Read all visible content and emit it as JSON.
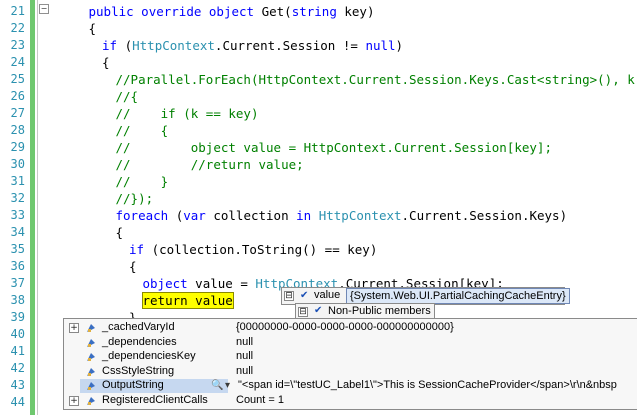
{
  "editor": {
    "collapse_glyph": "−",
    "lines": [
      {
        "num": "21",
        "indent": 3,
        "tokens": [
          {
            "t": "public override object ",
            "c": "kw"
          },
          {
            "t": "Get(",
            "c": ""
          },
          {
            "t": "string",
            "c": "kw"
          },
          {
            "t": " key)",
            "c": ""
          }
        ]
      },
      {
        "num": "22",
        "indent": 3,
        "tokens": [
          {
            "t": "{",
            "c": ""
          }
        ]
      },
      {
        "num": "23",
        "indent": 4,
        "tokens": [
          {
            "t": "if",
            "c": "kw"
          },
          {
            "t": " (",
            "c": ""
          },
          {
            "t": "HttpContext",
            "c": "ty"
          },
          {
            "t": ".Current.Session != ",
            "c": ""
          },
          {
            "t": "null",
            "c": "kw"
          },
          {
            "t": ")",
            "c": ""
          }
        ]
      },
      {
        "num": "24",
        "indent": 4,
        "tokens": [
          {
            "t": "{",
            "c": ""
          }
        ]
      },
      {
        "num": "25",
        "indent": 5,
        "tokens": [
          {
            "t": "//Parallel.ForEach(HttpContext.Current.Session.Keys.Cast<string>(), k =>",
            "c": "cm"
          }
        ]
      },
      {
        "num": "26",
        "indent": 5,
        "tokens": [
          {
            "t": "//{",
            "c": "cm"
          }
        ]
      },
      {
        "num": "27",
        "indent": 5,
        "tokens": [
          {
            "t": "//    if (k == key)",
            "c": "cm"
          }
        ]
      },
      {
        "num": "28",
        "indent": 5,
        "tokens": [
          {
            "t": "//    {",
            "c": "cm"
          }
        ]
      },
      {
        "num": "29",
        "indent": 5,
        "tokens": [
          {
            "t": "//        object value = HttpContext.Current.Session[key];",
            "c": "cm"
          }
        ]
      },
      {
        "num": "30",
        "indent": 5,
        "tokens": [
          {
            "t": "//        //return value;",
            "c": "cm"
          }
        ]
      },
      {
        "num": "31",
        "indent": 5,
        "tokens": [
          {
            "t": "//    }",
            "c": "cm"
          }
        ]
      },
      {
        "num": "32",
        "indent": 5,
        "tokens": [
          {
            "t": "//});",
            "c": "cm"
          }
        ]
      },
      {
        "num": "33",
        "indent": 5,
        "tokens": [
          {
            "t": "foreach",
            "c": "kw"
          },
          {
            "t": " (",
            "c": ""
          },
          {
            "t": "var",
            "c": "kw"
          },
          {
            "t": " collection ",
            "c": ""
          },
          {
            "t": "in",
            "c": "kw"
          },
          {
            "t": " ",
            "c": ""
          },
          {
            "t": "HttpContext",
            "c": "ty"
          },
          {
            "t": ".Current.Session.Keys)",
            "c": ""
          }
        ]
      },
      {
        "num": "34",
        "indent": 5,
        "tokens": [
          {
            "t": "{",
            "c": ""
          }
        ]
      },
      {
        "num": "35",
        "indent": 6,
        "tokens": [
          {
            "t": "if",
            "c": "kw"
          },
          {
            "t": " (collection.ToString() == key)",
            "c": ""
          }
        ]
      },
      {
        "num": "36",
        "indent": 6,
        "tokens": [
          {
            "t": "{",
            "c": ""
          }
        ]
      },
      {
        "num": "37",
        "indent": 7,
        "tokens": [
          {
            "t": "object",
            "c": "kw"
          },
          {
            "t": " value = ",
            "c": ""
          },
          {
            "t": "HttpContext",
            "c": "ty"
          },
          {
            "t": ".Current.Session[key];",
            "c": ""
          }
        ]
      },
      {
        "num": "38",
        "indent": 7,
        "tokens": [
          {
            "t": "return value",
            "c": "hl"
          }
        ]
      },
      {
        "num": "39",
        "indent": 6,
        "tokens": [
          {
            "t": "}",
            "c": ""
          }
        ]
      },
      {
        "num": "40",
        "indent": 0,
        "tokens": []
      },
      {
        "num": "41",
        "indent": 0,
        "tokens": []
      },
      {
        "num": "42",
        "indent": 0,
        "tokens": []
      },
      {
        "num": "43",
        "indent": 0,
        "tokens": []
      },
      {
        "num": "44",
        "indent": 0,
        "tokens": []
      }
    ]
  },
  "datatip_header": {
    "expander": "⊟",
    "name": "value",
    "value": "{System.Web.UI.PartialCachingCacheEntry}"
  },
  "datatip_nonpublic": {
    "expander": "⊟",
    "label": "Non-Public members"
  },
  "datatip_members": [
    {
      "expander": "+",
      "name": "_cachedVaryId",
      "value": "{00000000-0000-0000-0000-000000000000}",
      "selected": false,
      "visualizer": false
    },
    {
      "expander": "",
      "name": "_dependencies",
      "value": "null",
      "selected": false,
      "visualizer": false
    },
    {
      "expander": "",
      "name": "_dependenciesKey",
      "value": "null",
      "selected": false,
      "visualizer": false
    },
    {
      "expander": "",
      "name": "CssStyleString",
      "value": "null",
      "selected": false,
      "visualizer": false
    },
    {
      "expander": "",
      "name": "OutputString",
      "value": "\"<span id=\\\"testUC_Label1\\\">This is SessionCacheProvider</span>\\r\\n&nbsp",
      "selected": true,
      "visualizer": true
    },
    {
      "expander": "+",
      "name": "RegisteredClientCalls",
      "value": "Count = 1",
      "selected": false,
      "visualizer": false
    }
  ],
  "icons": {
    "field": "field-icon",
    "magnifier": "magnifier-icon",
    "dropdown": "dropdown-arrow-icon"
  },
  "visualizer_glyph": "🔍",
  "dropdown_glyph": "▾",
  "colors": {
    "keyword": "#0000ff",
    "type": "#2b91af",
    "comment": "#008000",
    "highlight": "#ffff00",
    "change_bar": "#6fc86f"
  }
}
